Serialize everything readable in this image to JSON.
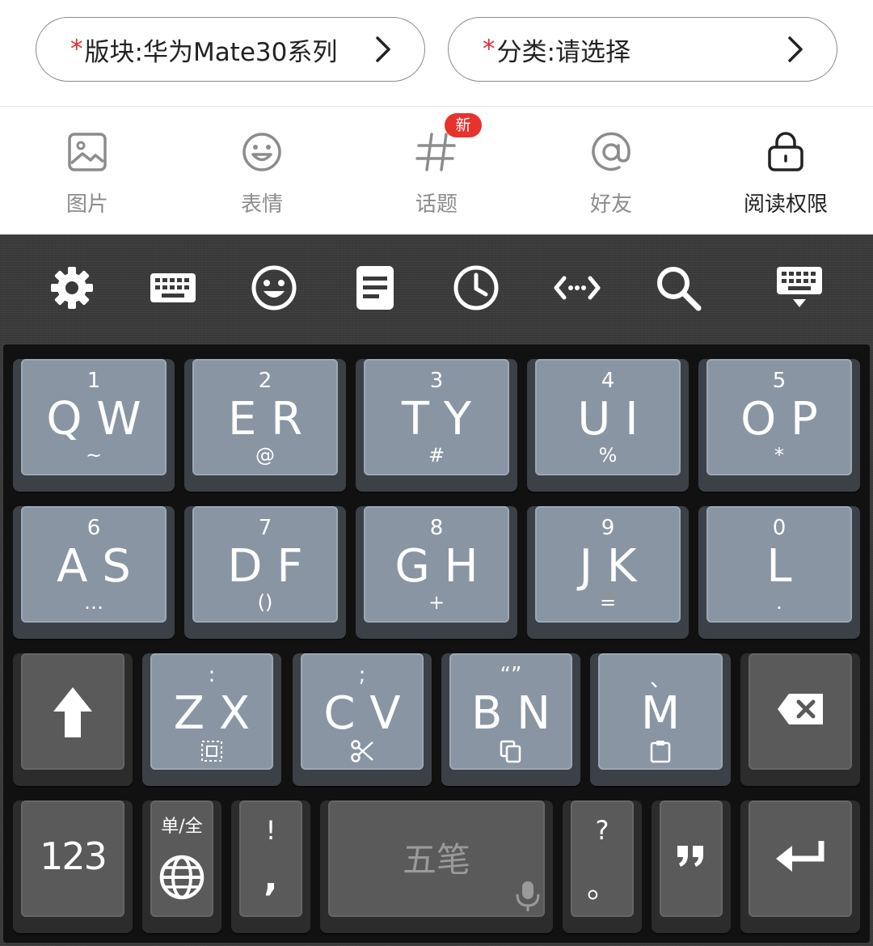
{
  "selectors": {
    "board": {
      "required_mark": "*",
      "label": "版块:华为Mate30系列"
    },
    "category": {
      "required_mark": "*",
      "label": "分类:请选择"
    }
  },
  "toolbar": {
    "items": [
      {
        "label": "图片",
        "icon": "image-icon"
      },
      {
        "label": "表情",
        "icon": "smiley-icon"
      },
      {
        "label": "话题",
        "icon": "hashtag-icon",
        "badge": "新"
      },
      {
        "label": "好友",
        "icon": "at-icon"
      },
      {
        "label": "阅读权限",
        "icon": "lock-icon",
        "active": true
      }
    ]
  },
  "keyboard": {
    "top_icons": [
      "settings-icon",
      "keyboard-icon",
      "emoji-icon",
      "clipboard-icon",
      "history-icon",
      "cursor-move-icon",
      "search-icon",
      "hide-keyboard-icon"
    ],
    "row1": [
      {
        "num": "1",
        "main": "Q W",
        "sub": "~"
      },
      {
        "num": "2",
        "main": "E R",
        "sub": "@"
      },
      {
        "num": "3",
        "main": "T Y",
        "sub": "#"
      },
      {
        "num": "4",
        "main": "U I",
        "sub": "%"
      },
      {
        "num": "5",
        "main": "O P",
        "sub": "*"
      }
    ],
    "row2": [
      {
        "num": "6",
        "main": "A S",
        "sub": "…"
      },
      {
        "num": "7",
        "main": "D F",
        "sub": "()"
      },
      {
        "num": "8",
        "main": "G H",
        "sub": "+"
      },
      {
        "num": "9",
        "main": "J K",
        "sub": "="
      },
      {
        "num": "0",
        "main": "L",
        "sub": "."
      }
    ],
    "row3": [
      {
        "sup": ":",
        "main": "Z X"
      },
      {
        "sup": ";",
        "main": "C V"
      },
      {
        "sup": "“”",
        "main": "B N"
      },
      {
        "sup": "、",
        "main": "M"
      }
    ],
    "numbers_key": "123",
    "half_full": "单/全",
    "punct1_top": "!",
    "punct1_bottom": ",",
    "space_label": "五笔",
    "punct2_top": "?",
    "punct2_bottom": "。",
    "quote_key": "”"
  }
}
